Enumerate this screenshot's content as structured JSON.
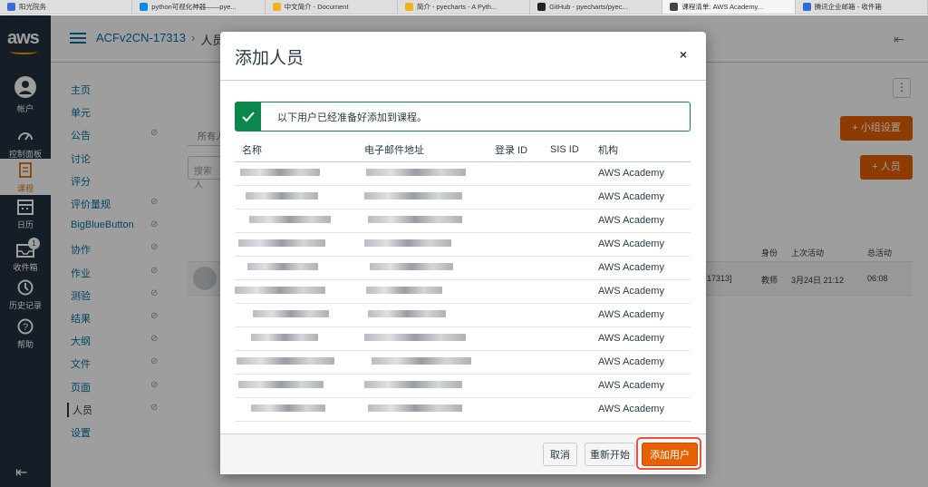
{
  "tabs": [
    {
      "label": "阳光院务",
      "icon_color": "#3b6bd8",
      "active": false
    },
    {
      "label": "python可视化神器——pye...",
      "icon_color": "#0f88eb",
      "active": false
    },
    {
      "label": "中文简介 - Document",
      "icon_color": "#f2b21b",
      "active": false
    },
    {
      "label": "简介 - pyecharts - A Pyth...",
      "icon_color": "#f2b21b",
      "active": false
    },
    {
      "label": "GitHub - pyecharts/pyec...",
      "icon_color": "#222222",
      "active": false
    },
    {
      "label": "课程清单: AWS Academy...",
      "icon_color": "#444444",
      "active": true
    },
    {
      "label": "腾讯企业邮箱 - 收件箱",
      "icon_color": "#2f6ad9",
      "active": false
    }
  ],
  "global_nav": {
    "logo": "aws",
    "items": [
      {
        "label": "帐户",
        "icon": "account-icon"
      },
      {
        "label": "控制面板",
        "icon": "dashboard-icon"
      },
      {
        "label": "课程",
        "icon": "courses-icon",
        "active": true
      },
      {
        "label": "日历",
        "icon": "calendar-icon"
      },
      {
        "label": "收件箱",
        "icon": "inbox-icon",
        "badge": "1"
      },
      {
        "label": "历史记录",
        "icon": "history-icon"
      },
      {
        "label": "帮助",
        "icon": "help-icon"
      }
    ]
  },
  "breadcrumb": {
    "course": "ACFv2CN-17313",
    "sep": "›",
    "current": "人员"
  },
  "course_nav": [
    "主页",
    "单元",
    "公告",
    "讨论",
    "评分",
    "评价量规",
    "BigBlueButton",
    "协作",
    "作业",
    "测验",
    "结果",
    "大纲",
    "文件",
    "页面",
    "人员",
    "设置"
  ],
  "background": {
    "tab_all": "所有人",
    "search_placeholder": "搜索人",
    "group_settings_btn": "+ 小组设置",
    "add_people_btn": "+ 人员",
    "col_role": "身份",
    "col_last_activity": "上次活动",
    "col_total_activity": "总活动",
    "row_section": "17313]",
    "row_role": "教师",
    "row_last_activity": "3月24日 21:12",
    "row_total_activity": "06:08"
  },
  "modal": {
    "title": "添加人员",
    "close": "×",
    "alert": "以下用户已经准备好添加到课程。",
    "columns": [
      "名称",
      "电子邮件地址",
      "登录 ID",
      "SIS ID",
      "机构"
    ],
    "rows": [
      {
        "institution": "AWS Academy"
      },
      {
        "institution": "AWS Academy"
      },
      {
        "institution": "AWS Academy"
      },
      {
        "institution": "AWS Academy"
      },
      {
        "institution": "AWS Academy"
      },
      {
        "institution": "AWS Academy"
      },
      {
        "institution": "AWS Academy"
      },
      {
        "institution": "AWS Academy"
      },
      {
        "institution": "AWS Academy"
      },
      {
        "institution": "AWS Academy"
      },
      {
        "institution": "AWS Academy"
      }
    ],
    "buttons": {
      "cancel": "取消",
      "restart": "重新开始",
      "add": "添加用户"
    }
  },
  "colors": {
    "nav_bg": "#232f3e",
    "accent": "#e66000",
    "success": "#0b874b",
    "link": "#0770a3"
  }
}
